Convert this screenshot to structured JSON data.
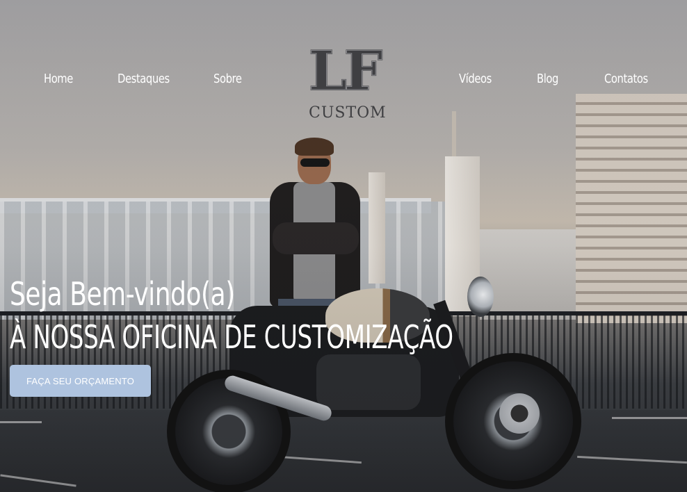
{
  "nav": {
    "items": [
      {
        "label": "Home"
      },
      {
        "label": "Destaques"
      },
      {
        "label": "Sobre"
      },
      {
        "label": "Vídeos"
      },
      {
        "label": "Blog"
      },
      {
        "label": "Contatos"
      }
    ]
  },
  "logo": {
    "mark": "LF",
    "subtitle": "CUSTOM"
  },
  "hero": {
    "title": "Seja Bem-vindo(a)",
    "subtitle": "À NOSSA OFICINA DE CUSTOMIZAÇÃO",
    "cta_label": "FAÇA SEU ORÇAMENTO",
    "image": "man-with-custom-motorcycle-photo"
  },
  "colors": {
    "nav_text": "#ffffff",
    "logo": "#3f3f42",
    "cta_background": "#aec3df",
    "cta_text": "#ffffff"
  }
}
